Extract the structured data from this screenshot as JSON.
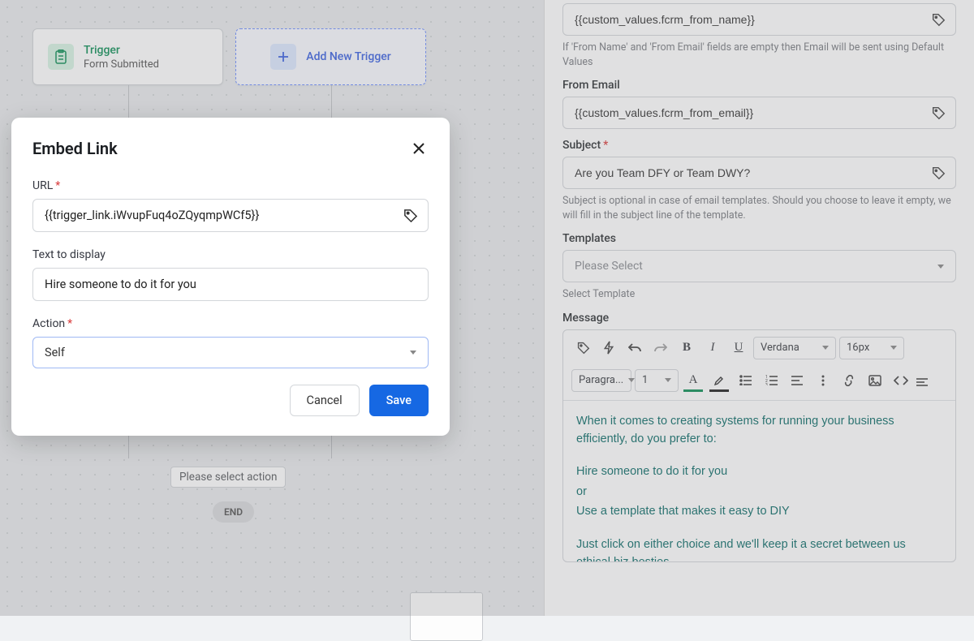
{
  "canvas": {
    "trigger": {
      "title": "Trigger",
      "subtitle": "Form Submitted"
    },
    "add_trigger": {
      "label": "Add New Trigger"
    },
    "action_placeholder": "Please select action",
    "end_label": "END"
  },
  "modal": {
    "title": "Embed Link",
    "url_label": "URL",
    "url_value": "{{trigger_link.iWvupFuq4oZQyqmpWCf5}}",
    "text_label": "Text to display",
    "text_value": "Hire someone to do it for you",
    "action_label": "Action",
    "action_value": "Self",
    "cancel": "Cancel",
    "save": "Save"
  },
  "panel": {
    "from_name_value": "{{custom_values.fcrm_from_name}}",
    "from_name_help": "If 'From Name' and 'From Email' fields are empty then Email will be sent using Default Values",
    "from_email_label": "From Email",
    "from_email_value": "{{custom_values.fcrm_from_email}}",
    "subject_label": "Subject",
    "subject_value": "Are you Team DFY or Team DWY?",
    "subject_help": "Subject is optional in case of email templates. Should you choose to leave it empty, we will fill in the subject line of the template.",
    "templates_label": "Templates",
    "templates_placeholder": "Please Select",
    "templates_help": "Select Template",
    "message_label": "Message",
    "toolbar": {
      "font": "Verdana",
      "size": "16px",
      "block": "Paragra...",
      "lineheight": "1"
    },
    "body": {
      "p1": "When it comes to creating systems for running your business efficiently, do you prefer to:",
      "p2": "Hire someone to do it for you",
      "p3": "or",
      "p4": "Use a template that makes it easy to DIY",
      "p5": "Just click on either choice and we'll keep it a secret between us ethical biz besties."
    }
  }
}
